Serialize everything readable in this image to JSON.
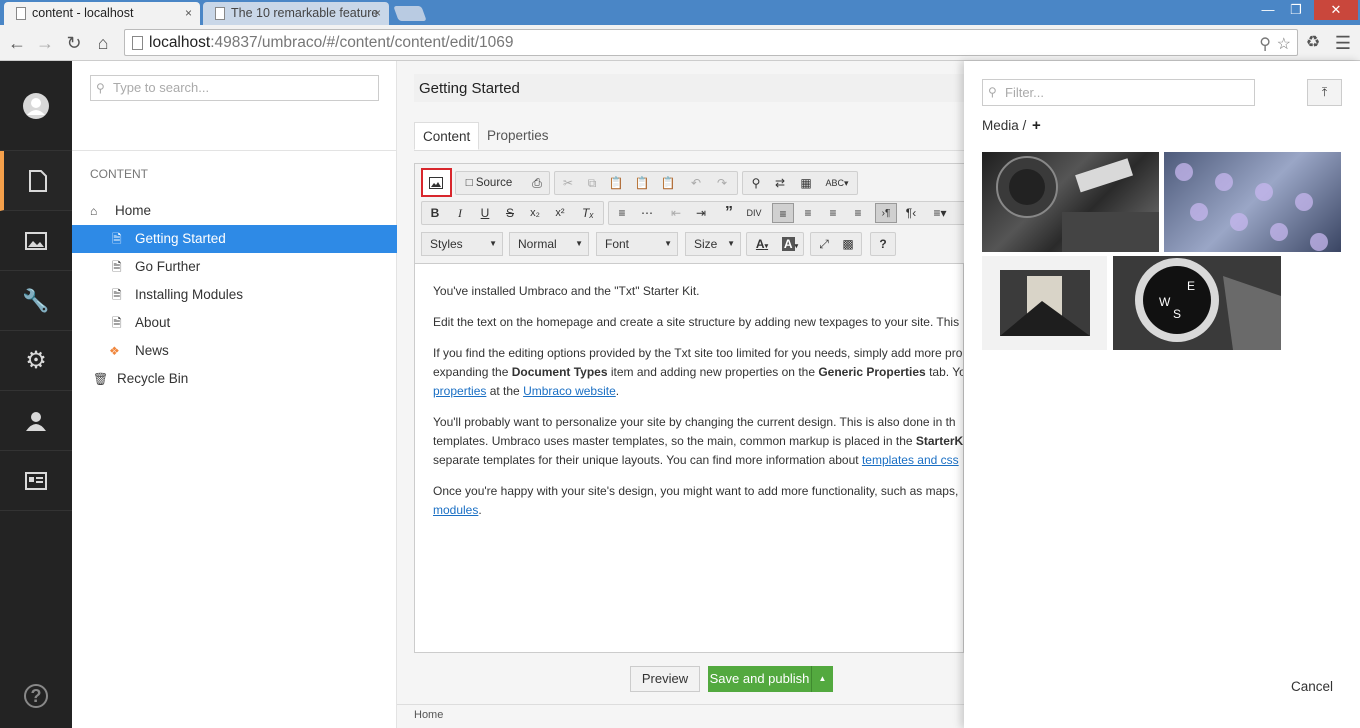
{
  "browser": {
    "tabs": [
      {
        "label": "content - localhost",
        "close": "×"
      },
      {
        "label": "The 10 remarkable feature",
        "close": "×"
      }
    ],
    "url_host": "localhost",
    "url_rest": ":49837/umbraco/#/content/content/edit/1069"
  },
  "tree": {
    "search_placeholder": "Type to search...",
    "section_title": "CONTENT",
    "nodes": [
      {
        "label": "Home"
      },
      {
        "label": "Getting Started",
        "selected": true
      },
      {
        "label": "Go Further"
      },
      {
        "label": "Installing Modules"
      },
      {
        "label": "About"
      },
      {
        "label": "News"
      },
      {
        "label": "Recycle Bin"
      }
    ]
  },
  "editor": {
    "document_name": "Getting Started",
    "tabs": [
      {
        "label": "Content"
      },
      {
        "label": "Properties"
      }
    ],
    "toolbar": {
      "source_label": "Source",
      "styles": "Styles",
      "format": "Normal",
      "font": "Font",
      "size": "Size"
    },
    "body": {
      "p1": "You've installed Umbraco and the \"Txt\" Starter Kit.",
      "p2": "Edit the text on the homepage and create a site structure by adding new texpages to your site. This",
      "p3a": "If you find the editing options provided by the Txt site too limited for you needs, simply add more pro",
      "p3b_pre": "expanding the ",
      "p3b_bold1": "Document Types",
      "p3b_mid": " item and adding new properties on the ",
      "p3b_bold2": "Generic Properties",
      "p3b_post": " tab. Yo",
      "p3c_link1": "properties",
      "p3c_mid": " at the ",
      "p3c_link2": "Umbraco website",
      "p3c_post": ".",
      "p4a": "You'll probably want to personalize your site by changing the current design. This is also done in th",
      "p4b_pre": "templates. Umbraco uses master templates, so the main, common markup is placed in the ",
      "p4b_bold": "StarterK",
      "p4c_pre": "separate templates for their unique layouts. You can find more information about ",
      "p4c_link": "templates and css",
      "p5a": "Once you're happy with your site's design, you might want to add more functionality, such as maps, ",
      "p5b_link": "modules",
      "p5b_post": "."
    },
    "preview_label": "Preview",
    "save_label": "Save and publish",
    "breadcrumb": "Home"
  },
  "media_picker": {
    "filter_placeholder": "Filter...",
    "crumb": "Media /",
    "add_symbol": "+",
    "cancel_label": "Cancel"
  },
  "colors": {
    "accent_blue": "#2e8ae6",
    "save_green": "#53a93f",
    "highlight_red": "#d8262c",
    "nav_bg": "#232323"
  }
}
